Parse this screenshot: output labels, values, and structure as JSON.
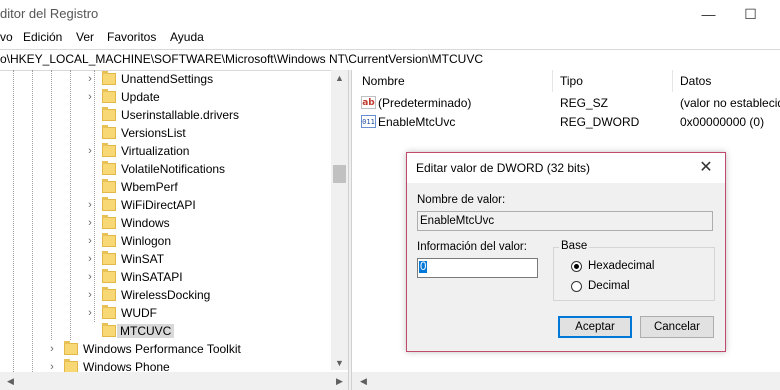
{
  "window": {
    "title": "ditor del Registro",
    "minimize_glyph": "—",
    "maximize_glyph": "☐"
  },
  "menu": [
    "vo",
    "Edición",
    "Ver",
    "Favoritos",
    "Ayuda"
  ],
  "address": "o\\HKEY_LOCAL_MACHINE\\SOFTWARE\\Microsoft\\Windows NT\\CurrentVersion\\MTCUVC",
  "tree": {
    "items": [
      {
        "label": "UnattendSettings",
        "expandable": true
      },
      {
        "label": "Update",
        "expandable": true
      },
      {
        "label": "Userinstallable.drivers",
        "expandable": false
      },
      {
        "label": "VersionsList",
        "expandable": false
      },
      {
        "label": "Virtualization",
        "expandable": true
      },
      {
        "label": "VolatileNotifications",
        "expandable": false
      },
      {
        "label": "WbemPerf",
        "expandable": false
      },
      {
        "label": "WiFiDirectAPI",
        "expandable": true
      },
      {
        "label": "Windows",
        "expandable": true
      },
      {
        "label": "Winlogon",
        "expandable": true
      },
      {
        "label": "WinSAT",
        "expandable": true
      },
      {
        "label": "WinSATAPI",
        "expandable": true
      },
      {
        "label": "WirelessDocking",
        "expandable": true
      },
      {
        "label": "WUDF",
        "expandable": true
      },
      {
        "label": "MTCUVC",
        "expandable": false,
        "selected": true
      }
    ],
    "parent_items": [
      {
        "label": "Windows Performance Toolkit"
      },
      {
        "label": "Windows Phone"
      }
    ]
  },
  "list": {
    "columns": [
      "Nombre",
      "Tipo",
      "Datos"
    ],
    "rows": [
      {
        "icon": "string-value-icon",
        "icon_text": "ab",
        "name": "(Predeterminado)",
        "type": "REG_SZ",
        "data": "(valor no establecido)"
      },
      {
        "icon": "binary-value-icon",
        "icon_text": "011",
        "name": "EnableMtcUvc",
        "type": "REG_DWORD",
        "data": "0x00000000 (0)"
      }
    ]
  },
  "dialog": {
    "title": "Editar valor de DWORD (32 bits)",
    "value_name_label": "Nombre de valor:",
    "value_name": "EnableMtcUvc",
    "value_data_label": "Información del valor:",
    "value_data": "0",
    "base_label": "Base",
    "base_options": [
      {
        "label": "Hexadecimal",
        "selected": true
      },
      {
        "label": "Decimal",
        "selected": false
      }
    ],
    "ok_label": "Aceptar",
    "cancel_label": "Cancelar",
    "close_glyph": "✕"
  },
  "colors": {
    "selection": "#0078d7",
    "dialog_border": "#c04a6a",
    "folder": "#f8d775"
  }
}
